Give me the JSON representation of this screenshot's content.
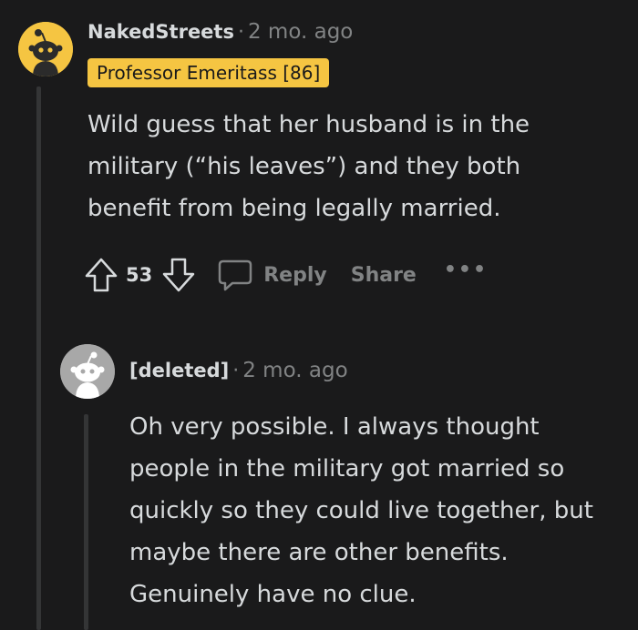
{
  "comment": {
    "author": "NakedStreets",
    "separator": "·",
    "time": "2 mo. ago",
    "flair": "Professor Emeritass [86]",
    "body": "Wild guess that her husband is in the military (“his leaves”) and they both benefit from being legally married.",
    "score": "53",
    "reply_label": "Reply",
    "share_label": "Share",
    "more_label": "•••",
    "colors": {
      "flair_bg": "#f5c542",
      "avatar_bg": "#f5c542",
      "background": "#1a1a1b"
    }
  },
  "reply": {
    "author": "[deleted]",
    "separator": "·",
    "time": "2 mo. ago",
    "body": "Oh very possible. I always thought people in the military got married so quickly so they could live together, but maybe there are other benefits. Genuinely have no clue."
  }
}
